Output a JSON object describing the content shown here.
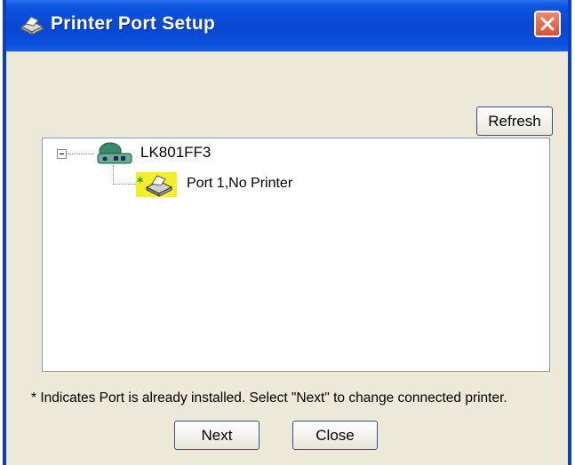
{
  "window": {
    "title": "Printer Port Setup",
    "title_icon": "printer-icon",
    "close_icon": "close-icon"
  },
  "buttons": {
    "refresh_label": "Refresh",
    "next_label": "Next",
    "close_label": "Close"
  },
  "tree": {
    "server": {
      "label": "LK801FF3",
      "icon": "print-server-icon",
      "expanded": true
    },
    "port": {
      "marker": "*",
      "label": "Port 1,No Printer",
      "icon": "printer-icon",
      "highlight_color": "#f2ef2a"
    }
  },
  "note": "* Indicates Port is already installed. Select \"Next\" to change connected printer.",
  "colors": {
    "titlebar": "#0847d2",
    "dialog_bg": "#ece9d8",
    "close_button": "#d9502f"
  }
}
